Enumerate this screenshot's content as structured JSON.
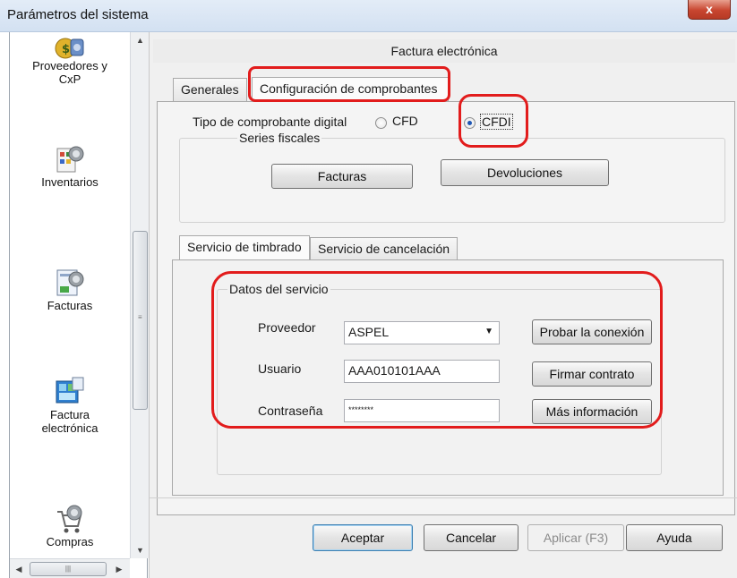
{
  "window": {
    "title": "Parámetros del sistema",
    "close_glyph": "x"
  },
  "sidebar": {
    "items": [
      {
        "label": "Proveedores y\nCxP",
        "icon": "money-bag-icon"
      },
      {
        "label": "Inventarios",
        "icon": "inventory-icon"
      },
      {
        "label": "Facturas",
        "icon": "invoice-icon"
      },
      {
        "label": "Factura\nelectrónica",
        "icon": "electronic-invoice-icon"
      },
      {
        "label": "Compras",
        "icon": "shopping-cart-icon"
      }
    ]
  },
  "panel": {
    "title": "Factura electrónica",
    "tabs": [
      "Generales",
      "Configuración de comprobantes"
    ],
    "tipo_label": "Tipo de comprobante digital",
    "radio_cfd": "CFD",
    "radio_cfdi": "CFDI",
    "selected_radio": "CFDI",
    "series_label": "Series fiscales",
    "btn_facturas": "Facturas",
    "btn_devoluciones": "Devoluciones",
    "subtabs": [
      "Servicio de timbrado",
      "Servicio de cancelación"
    ],
    "datos_label": "Datos del servicio",
    "proveedor_label": "Proveedor",
    "proveedor_value": "ASPEL",
    "usuario_label": "Usuario",
    "usuario_value": "AAA010101AAA",
    "contrasena_label": "Contraseña",
    "contrasena_value": "********",
    "btn_probar": "Probar la conexión",
    "btn_firmar": "Firmar contrato",
    "btn_mas": "Más información"
  },
  "footer": {
    "aceptar": "Aceptar",
    "cancelar": "Cancelar",
    "aplicar": "Aplicar (F3)",
    "ayuda": "Ayuda"
  },
  "colors": {
    "highlight": "#e21c1c",
    "accent": "#1d55b3"
  }
}
